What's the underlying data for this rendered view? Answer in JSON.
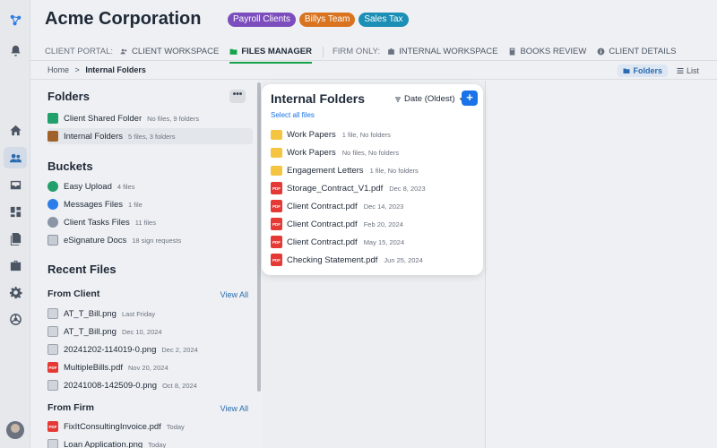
{
  "header": {
    "title": "Acme Corporation",
    "badges": [
      {
        "label": "Payroll Clients",
        "color": "#7c4dbd"
      },
      {
        "label": "Billys Team",
        "color": "#d9731f"
      },
      {
        "label": "Sales Tax",
        "color": "#1b8fb5"
      }
    ]
  },
  "nav": {
    "client_portal_label": "CLIENT PORTAL:",
    "client_workspace": "CLIENT WORKSPACE",
    "files_manager": "FILES MANAGER",
    "firm_only_label": "FIRM ONLY:",
    "internal_workspace": "INTERNAL WORKSPACE",
    "books_review": "BOOKS REVIEW",
    "client_details": "CLIENT DETAILS"
  },
  "breadcrumb": {
    "home": "Home",
    "sep": ">",
    "current": "Internal Folders"
  },
  "view_toggle": {
    "folders": "Folders",
    "list": "List"
  },
  "left": {
    "folders_title": "Folders",
    "more_label": "•••",
    "folders": [
      {
        "name": "Client Shared Folder",
        "meta": "No files, 9 folders"
      },
      {
        "name": "Internal Folders",
        "meta": "5 files, 3 folders"
      }
    ],
    "buckets_title": "Buckets",
    "buckets": [
      {
        "name": "Easy Upload",
        "meta": "4 files"
      },
      {
        "name": "Messages Files",
        "meta": "1 file"
      },
      {
        "name": "Client Tasks Files",
        "meta": "11 files"
      },
      {
        "name": "eSignature Docs",
        "meta": "18 sign requests"
      }
    ],
    "recent_title": "Recent Files",
    "from_client_title": "From Client",
    "from_client_view_all": "View All",
    "from_client": [
      {
        "name": "AT_T_Bill.png",
        "meta": "Last Friday",
        "type": "img"
      },
      {
        "name": "AT_T_Bill.png",
        "meta": "Dec 10, 2024",
        "type": "img"
      },
      {
        "name": "20241202-114019-0.png",
        "meta": "Dec 2, 2024",
        "type": "img"
      },
      {
        "name": "MultipleBills.pdf",
        "meta": "Nov 20, 2024",
        "type": "pdf"
      },
      {
        "name": "20241008-142509-0.png",
        "meta": "Oct 8, 2024",
        "type": "img"
      }
    ],
    "from_firm_title": "From Firm",
    "from_firm_view_all": "View All",
    "from_firm": [
      {
        "name": "FixItConsultingInvoice.pdf",
        "meta": "Today",
        "type": "pdf"
      },
      {
        "name": "Loan Application.png",
        "meta": "Today",
        "type": "img"
      }
    ]
  },
  "card": {
    "title": "Internal Folders",
    "sort_label": "Date (Oldest)",
    "add_label": "+",
    "select_all": "Select all files",
    "pdf_tag": "PDF",
    "items": [
      {
        "name": "Work Papers",
        "meta": "1 file, No folders",
        "type": "folder"
      },
      {
        "name": "Work Papers",
        "meta": "No files, No folders",
        "type": "folder"
      },
      {
        "name": "Engagement Letters",
        "meta": "1 file, No folders",
        "type": "folder"
      },
      {
        "name": "Storage_Contract_V1.pdf",
        "meta": "Dec 8, 2023",
        "type": "pdf"
      },
      {
        "name": "Client Contract.pdf",
        "meta": "Dec 14, 2023",
        "type": "pdf"
      },
      {
        "name": "Client Contract.pdf",
        "meta": "Feb 20, 2024",
        "type": "pdf"
      },
      {
        "name": "Client Contract.pdf",
        "meta": "May 15, 2024",
        "type": "pdf"
      },
      {
        "name": "Checking Statement.pdf",
        "meta": "Jun 25, 2024",
        "type": "pdf"
      }
    ]
  }
}
